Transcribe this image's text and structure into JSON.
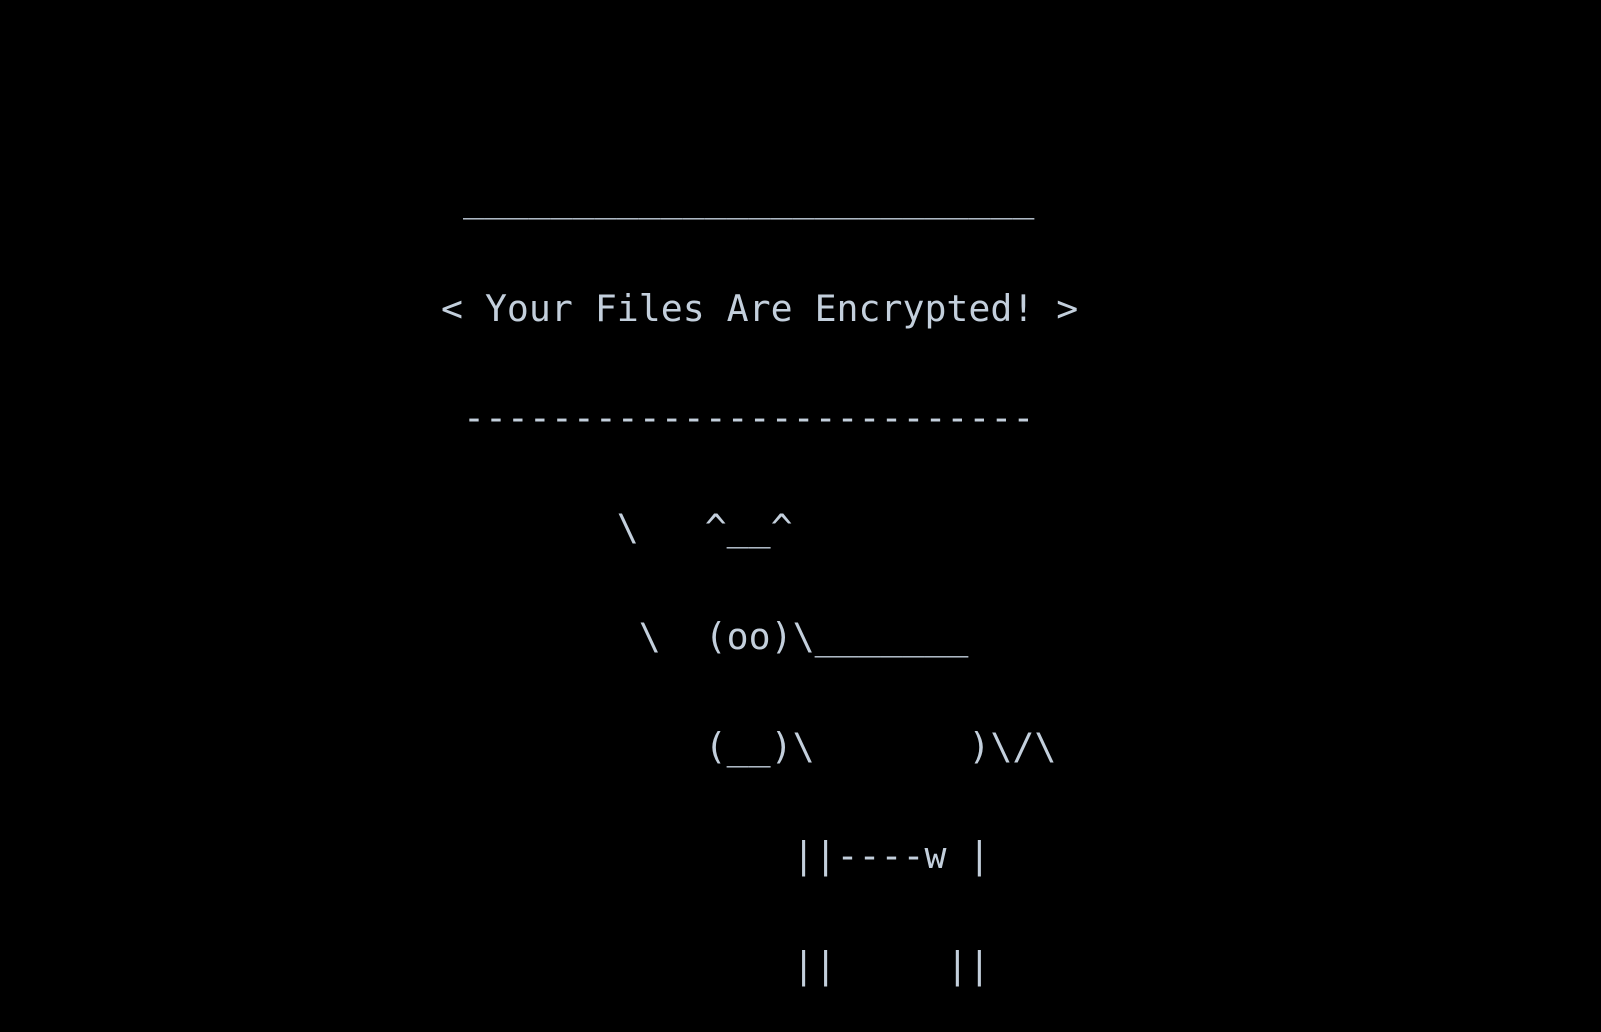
{
  "terminal": {
    "background": "#000000",
    "foreground": "#c3cfdc",
    "lines": [
      " __________________________",
      "< Your Files Are Encrypted! >",
      " --------------------------",
      "        \\   ^__^",
      "         \\  (oo)\\_______",
      "            (__)\\       )\\/\\",
      "                ||----w |",
      "                ||     ||"
    ]
  }
}
